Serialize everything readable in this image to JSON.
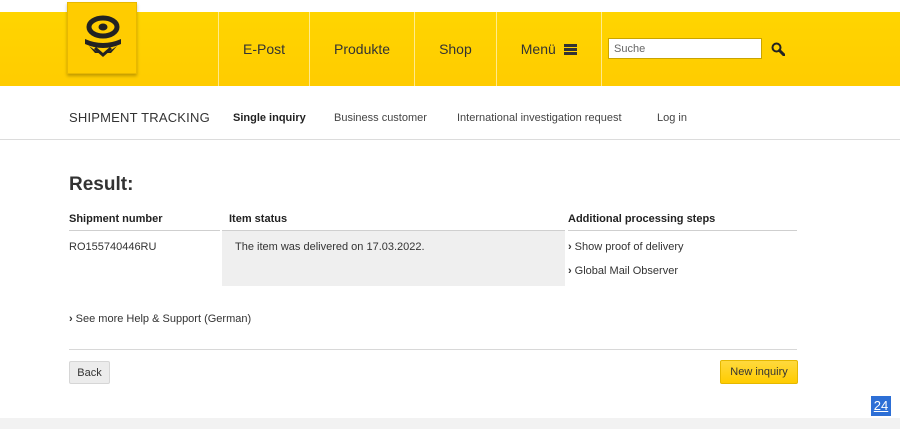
{
  "header": {
    "nav": [
      "E-Post",
      "Produkte",
      "Shop",
      "Menü"
    ],
    "search_placeholder": "Suche"
  },
  "subnav": {
    "title": "SHIPMENT TRACKING",
    "links": [
      "Single inquiry",
      "Business customer",
      "International investigation request",
      "Log in"
    ]
  },
  "result": {
    "title": "Result:",
    "columns": [
      "Shipment number",
      "Item status",
      "Additional processing steps"
    ],
    "shipment_number": "RO155740446RU",
    "status": "The item was delivered on 17.03.2022.",
    "steps": [
      "Show proof of delivery",
      "Global Mail Observer"
    ]
  },
  "help_link": "See more Help & Support (German)",
  "buttons": {
    "back": "Back",
    "new_inquiry": "New inquiry"
  },
  "badge": "24",
  "colors": {
    "brand_yellow": "#ffcc00",
    "text": "#333333",
    "badge_blue": "#2d6fd6"
  }
}
